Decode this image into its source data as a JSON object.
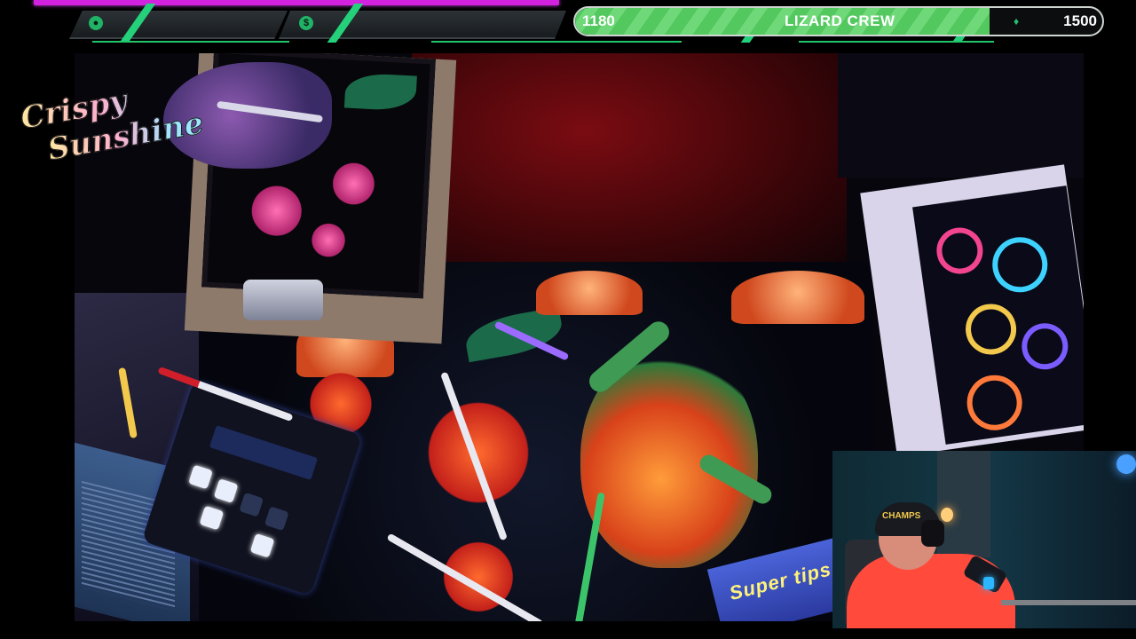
{
  "stream": {
    "logo_line1": "Crispy",
    "logo_line2": "Sunshine"
  },
  "topbar": {
    "stat_icons": [
      "person-icon",
      "coin-icon",
      "drop-icon"
    ],
    "crew_goal": {
      "current": "1180",
      "label": "LIZARD CREW",
      "goal": "1500",
      "progress_fraction": 0.787
    }
  },
  "scene": {
    "box_text": "Super tips"
  },
  "webcam": {
    "hat_text": "CHAMPS"
  },
  "colors": {
    "magenta_bar": "#d321e0",
    "crew_green": "#52c85e",
    "accent_green": "#24d07a"
  }
}
